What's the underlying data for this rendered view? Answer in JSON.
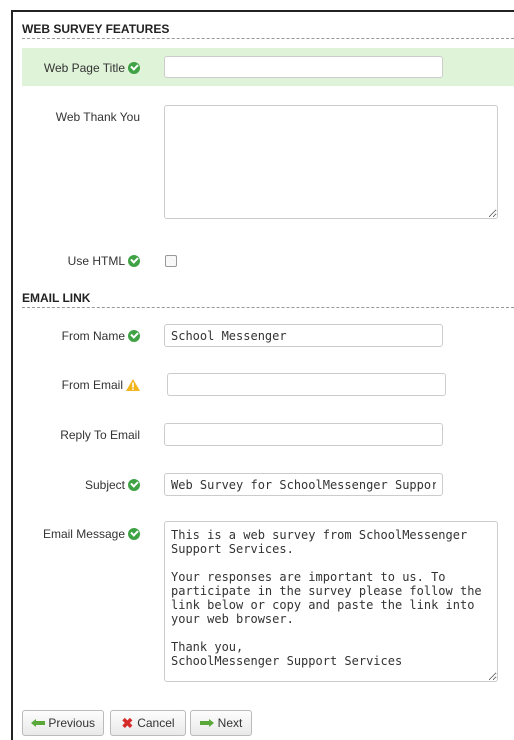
{
  "sections": {
    "web_survey": "WEB SURVEY FEATURES",
    "email_link": "EMAIL LINK"
  },
  "fields": {
    "web_page_title": {
      "label": "Web Page Title",
      "value": "",
      "icon": "check-icon"
    },
    "web_thank_you": {
      "label": "Web Thank You",
      "value": ""
    },
    "use_html": {
      "label": "Use HTML",
      "checked": false,
      "icon": "check-icon"
    },
    "from_name": {
      "label": "From Name",
      "value": "School Messenger",
      "icon": "check-icon"
    },
    "from_email": {
      "label": "From Email",
      "value": "",
      "icon": "warning-icon"
    },
    "reply_to_email": {
      "label": "Reply To Email",
      "value": ""
    },
    "subject": {
      "label": "Subject",
      "value": "Web Survey for SchoolMessenger Support",
      "icon": "check-icon"
    },
    "email_message": {
      "label": "Email Message",
      "icon": "check-icon",
      "value": "This is a web survey from SchoolMessenger Support Services.\n\nYour responses are important to us. To participate in the survey please follow the link below or copy and paste the link into your web browser.\n\nThank you,\nSchoolMessenger Support Services"
    }
  },
  "buttons": {
    "previous": "Previous",
    "cancel": "Cancel",
    "next": "Next"
  },
  "colors": {
    "highlight_row": "#dff3d8",
    "check": "#3fa244",
    "warning": "#f2b51b",
    "cancel_x": "#d62b2b",
    "arrow": "#5aa73a"
  }
}
